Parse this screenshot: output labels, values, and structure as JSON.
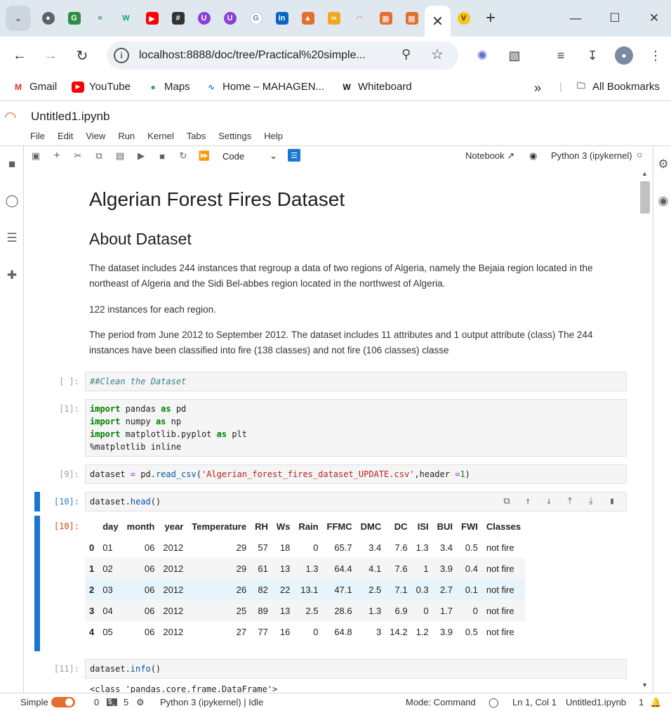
{
  "browser": {
    "tabs": [
      {
        "icon": "tab-search-icon"
      },
      {
        "icon": "globe-icon",
        "color": "#5f6368"
      },
      {
        "icon": "gfg-icon",
        "color": "#2f8d46"
      },
      {
        "icon": "w3-icon",
        "color": "#04aa6d"
      },
      {
        "icon": "w3schools-icon",
        "color": "#04aa6d"
      },
      {
        "icon": "youtube-icon",
        "color": "#ff0000"
      },
      {
        "icon": "calculator-icon",
        "color": "#333333"
      },
      {
        "icon": "u-icon",
        "color": "#8b3fd6"
      },
      {
        "icon": "u-icon",
        "color": "#8b3fd6"
      },
      {
        "icon": "google-icon",
        "color": "#4285f4"
      },
      {
        "icon": "linkedin-icon",
        "color": "#0a66c2"
      },
      {
        "icon": "chart-icon",
        "color": "#e46e2e"
      },
      {
        "icon": "link-icon",
        "color": "#f5a623"
      },
      {
        "icon": "jupyter-icon",
        "color": "#e46e2e"
      },
      {
        "icon": "book-icon",
        "color": "#e46e2e"
      },
      {
        "icon": "book-icon",
        "color": "#e46e2e"
      },
      {
        "icon": "close-icon",
        "active": true
      },
      {
        "icon": "v-icon",
        "color": "#f5c518"
      }
    ],
    "url": "localhost:8888/doc/tree/Practical%20simple...",
    "bookmarks": [
      {
        "label": "Gmail",
        "icon": "gmail-icon"
      },
      {
        "label": "YouTube",
        "icon": "youtube-icon"
      },
      {
        "label": "Maps",
        "icon": "maps-icon"
      },
      {
        "label": "Home – MAHAGEN...",
        "icon": "mahagen-icon"
      },
      {
        "label": "Whiteboard",
        "icon": "whiteboard-icon"
      }
    ],
    "all_bookmarks": "All Bookmarks"
  },
  "jupyter": {
    "title": "Untitled1.ipynb",
    "menus": [
      "File",
      "Edit",
      "View",
      "Run",
      "Kernel",
      "Tabs",
      "Settings",
      "Help"
    ],
    "celltype": "Code",
    "notebook_label": "Notebook",
    "kernel": "Python 3 (ipykernel)"
  },
  "notebook": {
    "h1": "Algerian Forest Fires Dataset",
    "h2": "About Dataset",
    "p1": "The dataset includes 244 instances that regroup a data of two regions of Algeria, namely the Bejaia region located in the northeast of Algeria and the Sidi Bel-abbes region located in the northwest of Algeria.",
    "p2": "122 instances for each region.",
    "p3": "The period from June 2012 to September 2012. The dataset includes 11 attributes and 1 output attribute (class) The 244 instances have been classified into fire (138 classes) and not fire (106 classes) classe",
    "cells": [
      {
        "prompt": "[ ]:"
      },
      {
        "prompt": "[1]:"
      },
      {
        "prompt": "[9]:"
      },
      {
        "prompt": "[10]:",
        "out_prompt": "[10]:"
      },
      {
        "prompt": "[11]:"
      }
    ],
    "code_info_output": "<class 'pandas.core.frame.DataFrame'>",
    "table": {
      "columns": [
        "",
        "day",
        "month",
        "year",
        "Temperature",
        "RH",
        "Ws",
        "Rain",
        "FFMC",
        "DMC",
        "DC",
        "ISI",
        "BUI",
        "FWI",
        "Classes"
      ],
      "rows": [
        [
          "0",
          "01",
          "06",
          "2012",
          "29",
          "57",
          "18",
          "0",
          "65.7",
          "3.4",
          "7.6",
          "1.3",
          "3.4",
          "0.5",
          "not fire"
        ],
        [
          "1",
          "02",
          "06",
          "2012",
          "29",
          "61",
          "13",
          "1.3",
          "64.4",
          "4.1",
          "7.6",
          "1",
          "3.9",
          "0.4",
          "not fire"
        ],
        [
          "2",
          "03",
          "06",
          "2012",
          "26",
          "82",
          "22",
          "13.1",
          "47.1",
          "2.5",
          "7.1",
          "0.3",
          "2.7",
          "0.1",
          "not fire"
        ],
        [
          "3",
          "04",
          "06",
          "2012",
          "25",
          "89",
          "13",
          "2.5",
          "28.6",
          "1.3",
          "6.9",
          "0",
          "1.7",
          "0",
          "not fire"
        ],
        [
          "4",
          "05",
          "06",
          "2012",
          "27",
          "77",
          "16",
          "0",
          "64.8",
          "3",
          "14.2",
          "1.2",
          "3.9",
          "0.5",
          "not fire"
        ]
      ]
    }
  },
  "status": {
    "mode_label": "Simple",
    "count_a": "0",
    "count_b": "5",
    "kernel_status": "Python 3 (ipykernel) | Idle",
    "mode": "Mode: Command",
    "position": "Ln 1, Col 1",
    "file": "Untitled1.ipynb",
    "notifications": "1"
  }
}
